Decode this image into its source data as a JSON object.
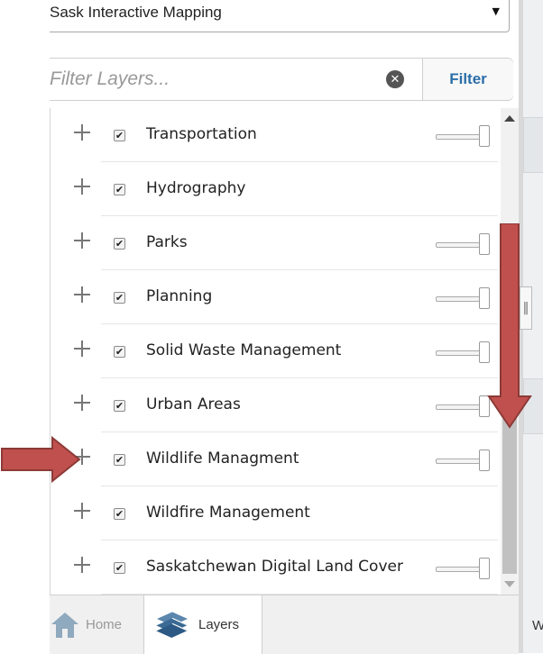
{
  "header": {
    "map_select_value": "Sask Interactive Mapping"
  },
  "filter": {
    "placeholder": "Filter Layers...",
    "button_label": "Filter"
  },
  "layers": [
    {
      "label": "Transportation",
      "checked": true,
      "slider": true
    },
    {
      "label": "Hydrography",
      "checked": true,
      "slider": false
    },
    {
      "label": "Parks",
      "checked": true,
      "slider": true
    },
    {
      "label": "Planning",
      "checked": true,
      "slider": true
    },
    {
      "label": "Solid Waste Management",
      "checked": true,
      "slider": true
    },
    {
      "label": "Urban Areas",
      "checked": true,
      "slider": true
    },
    {
      "label": "Wildlife Managment",
      "checked": true,
      "slider": true
    },
    {
      "label": "Wildfire Management",
      "checked": true,
      "slider": false
    },
    {
      "label": "Saskatchewan Digital Land Cover",
      "checked": true,
      "slider": true
    }
  ],
  "tabs": {
    "home": "Home",
    "layers": "Layers"
  },
  "map": {
    "corner_text": "W"
  },
  "colors": {
    "annotation_arrow": "#c0504d",
    "annotation_arrow_border": "#8c3a38",
    "filter_button_text": "#2b6ea8"
  }
}
